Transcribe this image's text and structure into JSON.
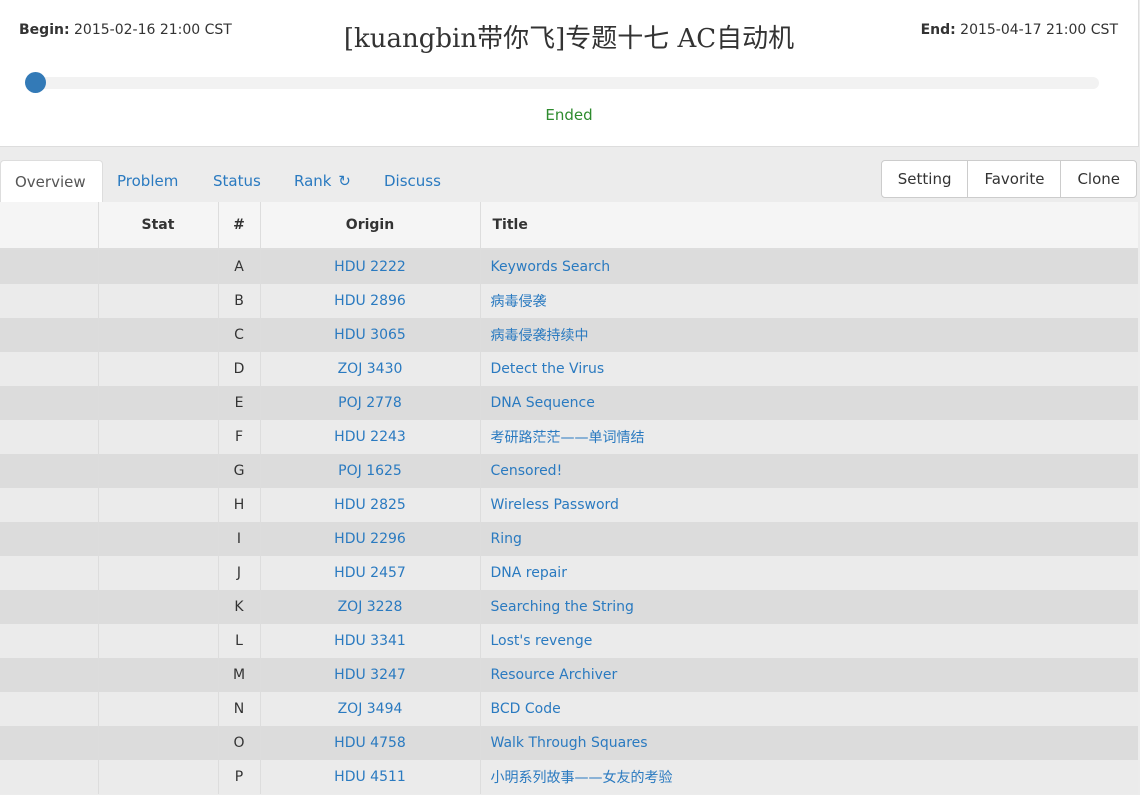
{
  "contest": {
    "begin_label": "Begin:",
    "begin_value": "2015-02-16 21:00 CST",
    "end_label": "End:",
    "end_value": "2015-04-17 21:00 CST",
    "title": "[kuangbin带你飞]专题十七 AC自动机",
    "status": "Ended",
    "accent_color": "#337ab7",
    "status_color": "#2e8b2e"
  },
  "tabs": [
    {
      "label": "Overview",
      "active": true
    },
    {
      "label": "Problem",
      "active": false
    },
    {
      "label": "Status",
      "active": false
    },
    {
      "label": "Rank",
      "icon": "refresh-icon",
      "active": false
    },
    {
      "label": "Discuss",
      "active": false
    }
  ],
  "actions": {
    "setting_label": "Setting",
    "favorite_label": "Favorite",
    "clone_label": "Clone"
  },
  "table": {
    "headers": [
      "",
      "Stat",
      "#",
      "Origin",
      "Title"
    ],
    "rows": [
      {
        "num": "A",
        "origin": "HDU 2222",
        "title": "Keywords Search"
      },
      {
        "num": "B",
        "origin": "HDU 2896",
        "title": "病毒侵袭"
      },
      {
        "num": "C",
        "origin": "HDU 3065",
        "title": "病毒侵袭持续中"
      },
      {
        "num": "D",
        "origin": "ZOJ 3430",
        "title": "Detect the Virus"
      },
      {
        "num": "E",
        "origin": "POJ 2778",
        "title": "DNA Sequence"
      },
      {
        "num": "F",
        "origin": "HDU 2243",
        "title": "考研路茫茫——单词情结"
      },
      {
        "num": "G",
        "origin": "POJ 1625",
        "title": "Censored!"
      },
      {
        "num": "H",
        "origin": "HDU 2825",
        "title": "Wireless Password"
      },
      {
        "num": "I",
        "origin": "HDU 2296",
        "title": "Ring"
      },
      {
        "num": "J",
        "origin": "HDU 2457",
        "title": "DNA repair"
      },
      {
        "num": "K",
        "origin": "ZOJ 3228",
        "title": "Searching the String"
      },
      {
        "num": "L",
        "origin": "HDU 3341",
        "title": "Lost's revenge"
      },
      {
        "num": "M",
        "origin": "HDU 3247",
        "title": "Resource Archiver"
      },
      {
        "num": "N",
        "origin": "ZOJ 3494",
        "title": "BCD Code"
      },
      {
        "num": "O",
        "origin": "HDU 4758",
        "title": "Walk Through Squares"
      },
      {
        "num": "P",
        "origin": "HDU 4511",
        "title": "小明系列故事——女友的考验"
      }
    ]
  }
}
